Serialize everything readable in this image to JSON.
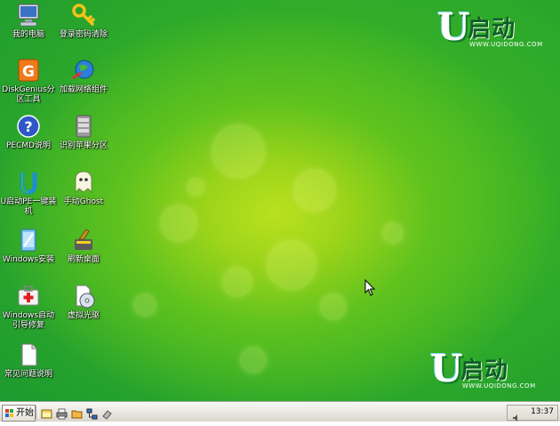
{
  "desktop": {
    "icons": [
      {
        "id": "my-computer",
        "label": "我的电脑",
        "icon": "computer-icon"
      },
      {
        "id": "password-clear",
        "label": "登录密码清除",
        "icon": "key-icon"
      },
      {
        "id": "diskgenius",
        "label": "DiskGenius分区工具",
        "icon": "diskgenius-icon"
      },
      {
        "id": "load-network",
        "label": "加载网络组件",
        "icon": "network-globe-icon"
      },
      {
        "id": "pecmd-help",
        "label": "PECMD说明",
        "icon": "help-icon"
      },
      {
        "id": "apple-partition",
        "label": "识别苹果分区",
        "icon": "disk-drive-icon"
      },
      {
        "id": "uqidong-reinstall",
        "label": "U启动PE一键装机",
        "icon": "u-logo-icon"
      },
      {
        "id": "manual-ghost",
        "label": "手动Ghost",
        "icon": "ghost-icon"
      },
      {
        "id": "windows-install",
        "label": "Windows安装",
        "icon": "windows-install-icon"
      },
      {
        "id": "refresh-desktop",
        "label": "刷新桌面",
        "icon": "refresh-brush-icon"
      },
      {
        "id": "boot-repair",
        "label": "Windows启动引导修复",
        "icon": "first-aid-kit-icon"
      },
      {
        "id": "virtual-cdrom",
        "label": "虚拟光驱",
        "icon": "cd-drive-icon"
      },
      {
        "id": "faq",
        "label": "常见问题说明",
        "icon": "document-icon"
      }
    ]
  },
  "branding": {
    "top": {
      "letter": "U",
      "name": "启动",
      "url": "WWW.UQIDONG.COM"
    },
    "bottom": {
      "letter": "U",
      "name": "启动",
      "url": "WWW.UQIDONG.COM"
    }
  },
  "taskbar": {
    "start_label": "开始",
    "quick_launch": [
      "explorer-icon",
      "printer-icon",
      "folder-icon",
      "network-icon",
      "eraser-icon"
    ],
    "clock": "13:37"
  },
  "colors": {
    "desktop_green": "#2eaa2a",
    "desktop_glow": "#b9e11f",
    "brand_dark": "#0f5e2a"
  }
}
